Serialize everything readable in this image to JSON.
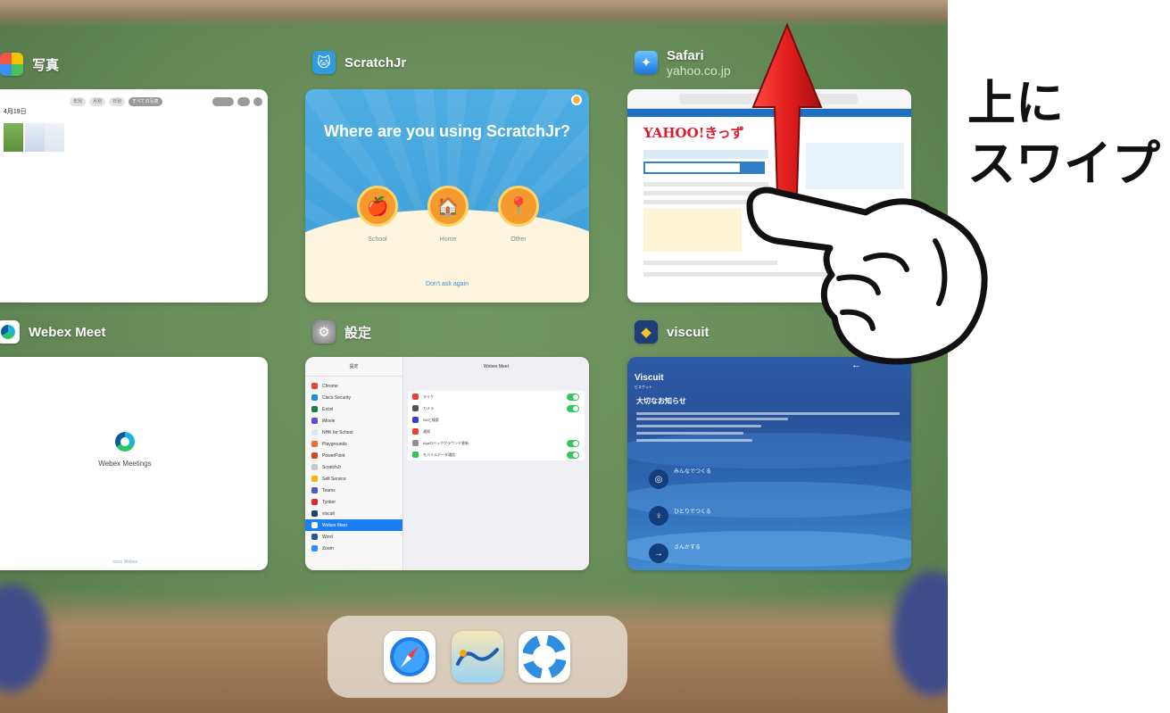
{
  "apps": {
    "photos": {
      "title": "写真",
      "tabs": [
        "年別",
        "月別",
        "日別",
        "すべての写真"
      ],
      "date": "4月19日"
    },
    "scratchjr": {
      "title": "ScratchJr",
      "question": "Where are you using ScratchJr?",
      "choices": [
        "School",
        "Home",
        "Other"
      ],
      "dont_ask": "Don't ask again"
    },
    "safari": {
      "title": "Safari",
      "subtitle": "yahoo.co.jp",
      "logo": "YAHOO!きっず"
    },
    "webex": {
      "title": "Webex Meet",
      "app_name": "Webex Meetings",
      "footer": "cisco Webex"
    },
    "settings": {
      "title": "設定",
      "sidebar_title": "設定",
      "main_title": "Webex Meet",
      "sidebar_items": [
        "Chrome",
        "Cisco Security",
        "Excel",
        "iMovie",
        "NHK for School",
        "Playgrounds",
        "PowerPoint",
        "ScratchJr",
        "Self Service",
        "Teams",
        "Tynker",
        "viscuit",
        "Webex Meet",
        "Word",
        "Zoom"
      ],
      "selected_item": "Webex Meet",
      "access_items": [
        "マイク",
        "カメラ",
        "Siriと検索",
        "通知",
        "Appのバックグラウンド更新",
        "モバイルデータ通信"
      ]
    },
    "viscuit": {
      "title": "viscuit",
      "brand": "Viscuit",
      "brand_sub": "ビスケット",
      "notice": "大切なお知らせ",
      "menu": [
        "みんなでつくる",
        "ひとりでつくる",
        "さんかする"
      ]
    }
  },
  "annotation": {
    "line1": "上に",
    "line2": "スワイプ"
  },
  "dock": [
    "safari-icon",
    "skymenu-icon",
    "lifebuoy-icon"
  ],
  "colors": {
    "background": "#6a8f5c",
    "arrow": "#e21e1e",
    "settings_selected": "#1a7ff5",
    "toggle_on": "#34c759"
  }
}
